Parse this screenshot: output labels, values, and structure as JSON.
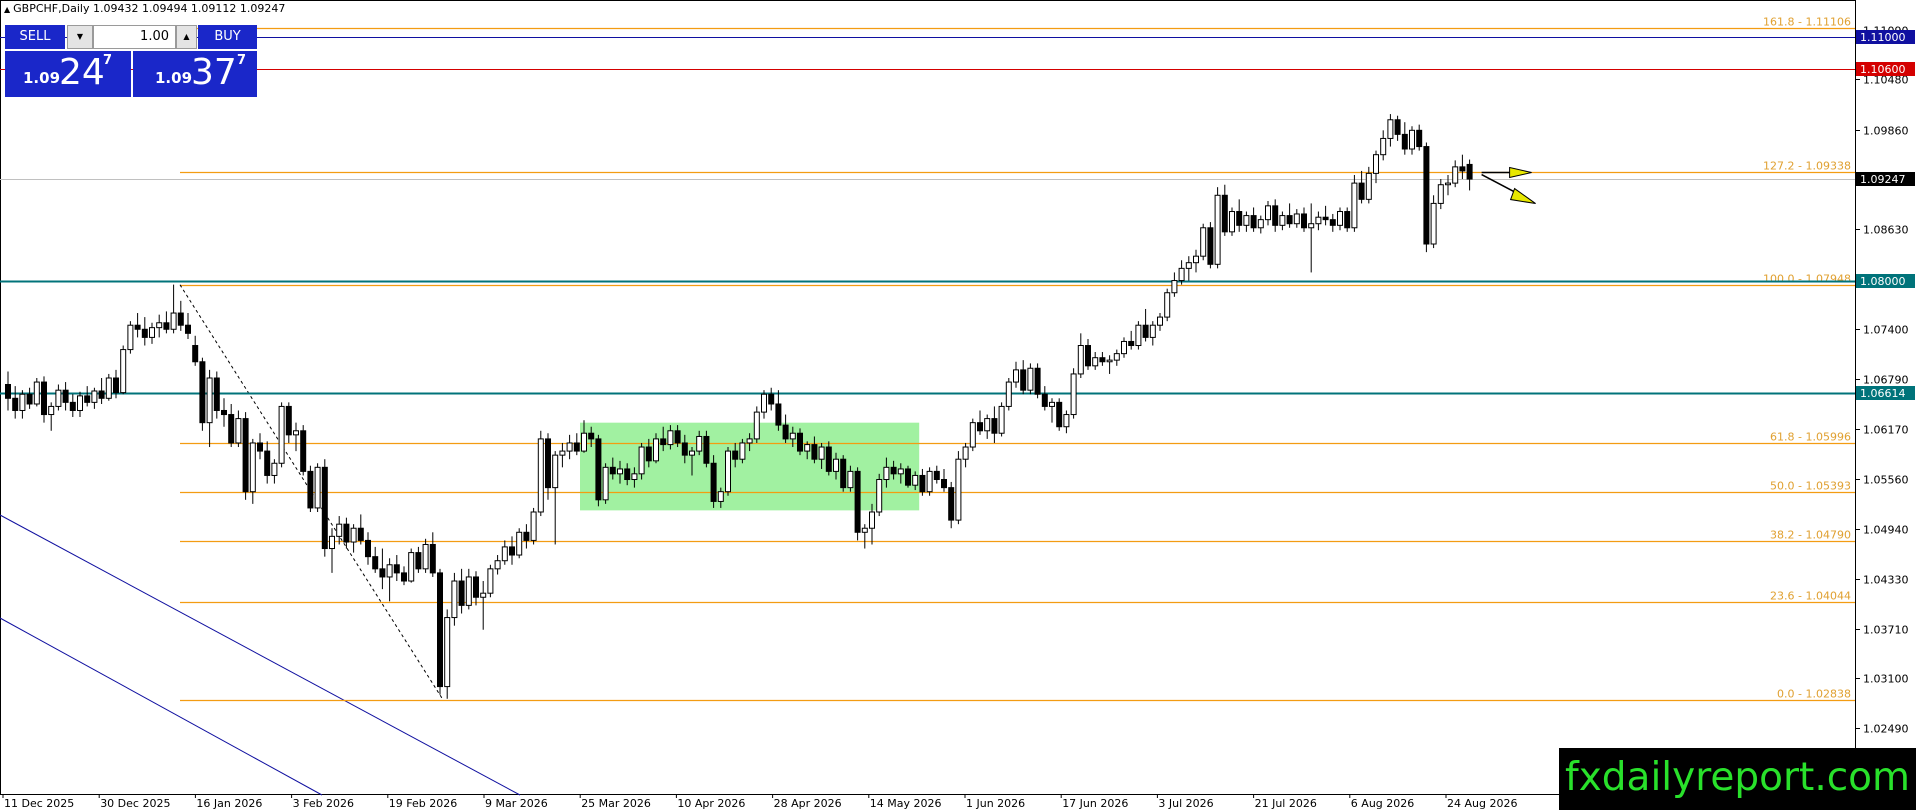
{
  "header": {
    "symbol_line": "GBPCHF,Daily  1.09432 1.09494 1.09112 1.09247"
  },
  "trade_panel": {
    "sell_label": "SELL",
    "buy_label": "BUY",
    "lot_value": "1.00",
    "sell_prefix": "1.09",
    "sell_big": "24",
    "sell_sup": "7",
    "buy_prefix": "1.09",
    "buy_big": "37",
    "buy_sup": "7"
  },
  "watermark": "fxdailyreport.com",
  "colors": {
    "up_candle": "#ffffff",
    "down_candle": "#000000",
    "fib_line": "#f39c12",
    "fib_text": "#e0a030",
    "teal_line": "#00737a",
    "blue_line": "#1010a0",
    "red_line": "#d40000",
    "consolidation_box": "#90ee90",
    "arrow_fill": "#e8e800",
    "brand_green": "#29e12b"
  },
  "chart_data": {
    "type": "candlestick",
    "symbol": "GBPCHF",
    "timeframe": "Daily",
    "ohlc_header": {
      "open": 1.09432,
      "high": 1.09494,
      "low": 1.09112,
      "close": 1.09247
    },
    "current_price": "1.09247",
    "y_ticks": [
      "1.11090",
      "1.10480",
      "1.09860",
      "1.08630",
      "1.07400",
      "1.06790",
      "1.06170",
      "1.05560",
      "1.04940",
      "1.04330",
      "1.03710",
      "1.03100",
      "1.02490"
    ],
    "x_ticks": [
      "11 Dec 2025",
      "30 Dec 2025",
      "16 Jan 2026",
      "3 Feb 2026",
      "19 Feb 2026",
      "9 Mar 2026",
      "25 Mar 2026",
      "10 Apr 2026",
      "28 Apr 2026",
      "14 May 2026",
      "1 Jun 2026",
      "17 Jun 2026",
      "3 Jul 2026",
      "21 Jul 2026",
      "6 Aug 2026",
      "24 Aug 2026"
    ],
    "fib_levels": [
      {
        "label": "161.8 - 1.11106",
        "price": 1.11106
      },
      {
        "label": "127.2 - 1.09338",
        "price": 1.09338
      },
      {
        "label": "100.0 - 1.07948",
        "price": 1.07948
      },
      {
        "label": "61.8 - 1.05996",
        "price": 1.05996
      },
      {
        "label": "50.0 - 1.05393",
        "price": 1.05393
      },
      {
        "label": "38.2 - 1.04790",
        "price": 1.0479
      },
      {
        "label": "23.6 - 1.04044",
        "price": 1.04044
      },
      {
        "label": "0.0 - 1.02838",
        "price": 1.02838
      }
    ],
    "horizontal_lines": [
      {
        "label": "1.11000",
        "price": 1.11,
        "color": "#1010a0"
      },
      {
        "label": "1.10600",
        "price": 1.106,
        "color": "#d40000"
      },
      {
        "label": "1.08000",
        "price": 1.08,
        "color": "#00737a"
      },
      {
        "label": "1.06614",
        "price": 1.06614,
        "color": "#00737a"
      }
    ],
    "consolidation_zone": {
      "start_bar": 80,
      "end_bar": 126,
      "high": 1.0625,
      "low": 1.0517
    },
    "candles": [
      [
        1.0672,
        1.0688,
        1.064,
        1.0655
      ],
      [
        1.0655,
        1.067,
        1.063,
        1.064
      ],
      [
        1.064,
        1.0665,
        1.063,
        1.066
      ],
      [
        1.066,
        1.0668,
        1.0642,
        1.0648
      ],
      [
        1.0648,
        1.068,
        1.0645,
        1.0675
      ],
      [
        1.0675,
        1.0682,
        1.0625,
        1.0635
      ],
      [
        1.0635,
        1.065,
        1.0615,
        1.0645
      ],
      [
        1.0645,
        1.0672,
        1.064,
        1.0665
      ],
      [
        1.0665,
        1.0675,
        1.064,
        1.065
      ],
      [
        1.065,
        1.066,
        1.0632,
        1.064
      ],
      [
        1.064,
        1.0663,
        1.0632,
        1.0658
      ],
      [
        1.0658,
        1.067,
        1.0645,
        1.065
      ],
      [
        1.065,
        1.0668,
        1.0642,
        1.0664
      ],
      [
        1.0664,
        1.068,
        1.0648,
        1.0655
      ],
      [
        1.0655,
        1.0685,
        1.0652,
        1.068
      ],
      [
        1.068,
        1.069,
        1.0655,
        1.0662
      ],
      [
        1.0662,
        1.072,
        1.066,
        1.0715
      ],
      [
        1.0715,
        1.075,
        1.071,
        1.0745
      ],
      [
        1.0745,
        1.076,
        1.073,
        1.074
      ],
      [
        1.074,
        1.0755,
        1.072,
        1.073
      ],
      [
        1.073,
        1.0748,
        1.0722,
        1.0742
      ],
      [
        1.0742,
        1.0758,
        1.073,
        1.0748
      ],
      [
        1.0748,
        1.0762,
        1.0735,
        1.074
      ],
      [
        1.074,
        1.0795,
        1.0735,
        1.076
      ],
      [
        1.076,
        1.0775,
        1.0738,
        1.0745
      ],
      [
        1.0745,
        1.076,
        1.0728,
        1.0735
      ],
      [
        1.072,
        1.0732,
        1.0695,
        1.07
      ],
      [
        1.07,
        1.0705,
        1.0615,
        1.0625
      ],
      [
        1.0625,
        1.069,
        1.0595,
        1.068
      ],
      [
        1.068,
        1.0688,
        1.063,
        1.064
      ],
      [
        1.064,
        1.0655,
        1.062,
        1.0635
      ],
      [
        1.0635,
        1.0648,
        1.0595,
        1.06
      ],
      [
        1.06,
        1.064,
        1.0595,
        1.063
      ],
      [
        1.063,
        1.0638,
        1.053,
        1.054
      ],
      [
        1.054,
        1.0605,
        1.0525,
        1.06
      ],
      [
        1.06,
        1.0612,
        1.058,
        1.059
      ],
      [
        1.059,
        1.0602,
        1.055,
        1.056
      ],
      [
        1.056,
        1.058,
        1.055,
        1.0575
      ],
      [
        1.0575,
        1.065,
        1.057,
        1.0645
      ],
      [
        1.0645,
        1.065,
        1.06,
        1.061
      ],
      [
        1.061,
        1.0625,
        1.059,
        1.0615
      ],
      [
        1.0615,
        1.0622,
        1.056,
        1.0565
      ],
      [
        1.0565,
        1.0572,
        1.0515,
        1.052
      ],
      [
        1.052,
        1.0575,
        1.0515,
        1.057
      ],
      [
        1.057,
        1.058,
        1.046,
        1.047
      ],
      [
        1.047,
        1.0495,
        1.044,
        1.0485
      ],
      [
        1.0485,
        1.051,
        1.0475,
        1.05
      ],
      [
        1.05,
        1.0508,
        1.047,
        1.0478
      ],
      [
        1.0478,
        1.05,
        1.0465,
        1.0495
      ],
      [
        1.0495,
        1.0512,
        1.0475,
        1.048
      ],
      [
        1.048,
        1.049,
        1.045,
        1.046
      ],
      [
        1.046,
        1.0472,
        1.044,
        1.0445
      ],
      [
        1.0445,
        1.047,
        1.042,
        1.0435
      ],
      [
        1.0435,
        1.0458,
        1.0405,
        1.045
      ],
      [
        1.045,
        1.0462,
        1.043,
        1.044
      ],
      [
        1.044,
        1.0448,
        1.0425,
        1.043
      ],
      [
        1.043,
        1.047,
        1.0428,
        1.0465
      ],
      [
        1.0465,
        1.0472,
        1.044,
        1.0445
      ],
      [
        1.0445,
        1.0482,
        1.044,
        1.0475
      ],
      [
        1.0475,
        1.049,
        1.0435,
        1.044
      ],
      [
        1.044,
        1.0445,
        1.029,
        1.03
      ],
      [
        1.03,
        1.0395,
        1.0285,
        1.0385
      ],
      [
        1.0385,
        1.044,
        1.0375,
        1.043
      ],
      [
        1.043,
        1.0445,
        1.039,
        1.04
      ],
      [
        1.04,
        1.0445,
        1.0395,
        1.0435
      ],
      [
        1.0435,
        1.0442,
        1.04,
        1.041
      ],
      [
        1.041,
        1.043,
        1.037,
        1.0415
      ],
      [
        1.0415,
        1.045,
        1.041,
        1.0445
      ],
      [
        1.0445,
        1.0462,
        1.0438,
        1.0455
      ],
      [
        1.0455,
        1.048,
        1.045,
        1.0472
      ],
      [
        1.0472,
        1.0485,
        1.045,
        1.0462
      ],
      [
        1.0462,
        1.0495,
        1.0458,
        1.049
      ],
      [
        1.049,
        1.05,
        1.047,
        1.048
      ],
      [
        1.048,
        1.052,
        1.0475,
        1.0515
      ],
      [
        1.0515,
        1.0615,
        1.051,
        1.0605
      ],
      [
        1.0605,
        1.0612,
        1.053,
        1.0545
      ],
      [
        1.0545,
        1.059,
        1.0475,
        1.0585
      ],
      [
        1.0585,
        1.06,
        1.057,
        1.059
      ],
      [
        1.059,
        1.061,
        1.058,
        1.06
      ],
      [
        1.06,
        1.0612,
        1.0585,
        1.059
      ],
      [
        1.059,
        1.0628,
        1.0588,
        1.0612
      ],
      [
        1.0612,
        1.062,
        1.0595,
        1.0605
      ],
      [
        1.0605,
        1.061,
        1.0522,
        1.053
      ],
      [
        1.053,
        1.0575,
        1.0525,
        1.057
      ],
      [
        1.057,
        1.0582,
        1.0555,
        1.0562
      ],
      [
        1.0562,
        1.0578,
        1.055,
        1.0568
      ],
      [
        1.0568,
        1.0575,
        1.0548,
        1.0555
      ],
      [
        1.0555,
        1.057,
        1.0545,
        1.0562
      ],
      [
        1.0562,
        1.06,
        1.0555,
        1.0595
      ],
      [
        1.0595,
        1.0605,
        1.057,
        1.0578
      ],
      [
        1.0578,
        1.0612,
        1.0575,
        1.0605
      ],
      [
        1.0605,
        1.062,
        1.059,
        1.0598
      ],
      [
        1.0598,
        1.0622,
        1.0592,
        1.0615
      ],
      [
        1.0615,
        1.0622,
        1.0595,
        1.06
      ],
      [
        1.06,
        1.061,
        1.0575,
        1.0585
      ],
      [
        1.0585,
        1.0595,
        1.056,
        1.059
      ],
      [
        1.059,
        1.0615,
        1.0585,
        1.0608
      ],
      [
        1.0608,
        1.0615,
        1.057,
        1.0575
      ],
      [
        1.0575,
        1.0585,
        1.052,
        1.0528
      ],
      [
        1.0528,
        1.0545,
        1.052,
        1.054
      ],
      [
        1.054,
        1.0595,
        1.0535,
        1.059
      ],
      [
        1.059,
        1.06,
        1.057,
        1.058
      ],
      [
        1.058,
        1.0605,
        1.0575,
        1.06
      ],
      [
        1.06,
        1.0612,
        1.059,
        1.0605
      ],
      [
        1.0605,
        1.0645,
        1.06,
        1.0638
      ],
      [
        1.0638,
        1.0665,
        1.063,
        1.066
      ],
      [
        1.066,
        1.0668,
        1.064,
        1.0648
      ],
      [
        1.0648,
        1.0665,
        1.0615,
        1.0622
      ],
      [
        1.0622,
        1.0635,
        1.06,
        1.0605
      ],
      [
        1.0605,
        1.062,
        1.0595,
        1.0612
      ],
      [
        1.0612,
        1.0618,
        1.0585,
        1.059
      ],
      [
        1.059,
        1.0602,
        1.058,
        1.0598
      ],
      [
        1.0598,
        1.0608,
        1.0575,
        1.058
      ],
      [
        1.058,
        1.06,
        1.0568,
        1.0595
      ],
      [
        1.0595,
        1.0602,
        1.056,
        1.0565
      ],
      [
        1.0565,
        1.0588,
        1.0555,
        1.058
      ],
      [
        1.058,
        1.0585,
        1.054,
        1.0545
      ],
      [
        1.0545,
        1.0572,
        1.054,
        1.0565
      ],
      [
        1.0565,
        1.057,
        1.048,
        1.049
      ],
      [
        1.049,
        1.05,
        1.047,
        1.0495
      ],
      [
        1.0495,
        1.0525,
        1.0475,
        1.0515
      ],
      [
        1.0515,
        1.0562,
        1.051,
        1.0555
      ],
      [
        1.0555,
        1.0582,
        1.0545,
        1.057
      ],
      [
        1.057,
        1.0578,
        1.0555,
        1.0562
      ],
      [
        1.0562,
        1.0575,
        1.055,
        1.0568
      ],
      [
        1.0568,
        1.0572,
        1.0545,
        1.0548
      ],
      [
        1.0548,
        1.0565,
        1.0542,
        1.056
      ],
      [
        1.056,
        1.0568,
        1.0535,
        1.054
      ],
      [
        1.054,
        1.057,
        1.0535,
        1.0565
      ],
      [
        1.0565,
        1.0572,
        1.055,
        1.0555
      ],
      [
        1.0555,
        1.0568,
        1.054,
        1.0545
      ],
      [
        1.0545,
        1.0552,
        1.0495,
        1.0505
      ],
      [
        1.0505,
        1.059,
        1.05,
        1.058
      ],
      [
        1.058,
        1.06,
        1.057,
        1.0595
      ],
      [
        1.0595,
        1.063,
        1.059,
        1.0625
      ],
      [
        1.0625,
        1.064,
        1.061,
        1.0615
      ],
      [
        1.0615,
        1.0635,
        1.0605,
        1.063
      ],
      [
        1.063,
        1.0645,
        1.06,
        1.0612
      ],
      [
        1.0612,
        1.065,
        1.0608,
        1.0645
      ],
      [
        1.0645,
        1.068,
        1.064,
        1.0675
      ],
      [
        1.0675,
        1.07,
        1.0668,
        1.069
      ],
      [
        1.069,
        1.0702,
        1.066,
        1.0665
      ],
      [
        1.0665,
        1.0698,
        1.066,
        1.0692
      ],
      [
        1.0692,
        1.0698,
        1.0655,
        1.066
      ],
      [
        1.066,
        1.067,
        1.064,
        1.0645
      ],
      [
        1.0645,
        1.0655,
        1.0625,
        1.065
      ],
      [
        1.065,
        1.0655,
        1.0615,
        1.062
      ],
      [
        1.062,
        1.064,
        1.0612,
        1.0635
      ],
      [
        1.0635,
        1.0692,
        1.063,
        1.0685
      ],
      [
        1.0685,
        1.0735,
        1.068,
        1.072
      ],
      [
        1.072,
        1.0728,
        1.069,
        1.0695
      ],
      [
        1.0695,
        1.0712,
        1.069,
        1.0705
      ],
      [
        1.0705,
        1.0712,
        1.0695,
        1.07
      ],
      [
        1.07,
        1.0708,
        1.0685,
        1.0702
      ],
      [
        1.0702,
        1.0715,
        1.0695,
        1.071
      ],
      [
        1.071,
        1.073,
        1.0705,
        1.0725
      ],
      [
        1.0725,
        1.0738,
        1.0715,
        1.072
      ],
      [
        1.072,
        1.075,
        1.0715,
        1.0745
      ],
      [
        1.0745,
        1.0765,
        1.0725,
        1.073
      ],
      [
        1.073,
        1.075,
        1.072,
        1.0745
      ],
      [
        1.0745,
        1.076,
        1.0738,
        1.0755
      ],
      [
        1.0755,
        1.079,
        1.075,
        1.0785
      ],
      [
        1.0785,
        1.081,
        1.078,
        1.08
      ],
      [
        1.08,
        1.0825,
        1.0795,
        1.0815
      ],
      [
        1.0815,
        1.083,
        1.08,
        1.0822
      ],
      [
        1.0822,
        1.0838,
        1.081,
        1.083
      ],
      [
        1.083,
        1.087,
        1.0825,
        1.0865
      ],
      [
        1.0865,
        1.0872,
        1.0815,
        1.082
      ],
      [
        1.082,
        1.0915,
        1.0815,
        1.0905
      ],
      [
        1.0905,
        1.0918,
        1.0855,
        1.086
      ],
      [
        1.086,
        1.089,
        1.0855,
        1.0885
      ],
      [
        1.0885,
        1.09,
        1.086,
        1.0868
      ],
      [
        1.0868,
        1.0885,
        1.086,
        1.088
      ],
      [
        1.088,
        1.089,
        1.086,
        1.0865
      ],
      [
        1.0865,
        1.088,
        1.0858,
        1.0875
      ],
      [
        1.0875,
        1.0898,
        1.0868,
        1.0892
      ],
      [
        1.0892,
        1.09,
        1.086,
        1.0868
      ],
      [
        1.0868,
        1.0885,
        1.0862,
        1.088
      ],
      [
        1.088,
        1.0895,
        1.0865,
        1.087
      ],
      [
        1.087,
        1.0888,
        1.0865,
        1.0882
      ],
      [
        1.0882,
        1.089,
        1.086,
        1.0865
      ],
      [
        1.0865,
        1.0895,
        1.081,
        1.087
      ],
      [
        1.087,
        1.0885,
        1.0862,
        1.0878
      ],
      [
        1.0878,
        1.0892,
        1.0868,
        1.0875
      ],
      [
        1.0875,
        1.0882,
        1.086,
        1.0868
      ],
      [
        1.0868,
        1.089,
        1.0862,
        1.0885
      ],
      [
        1.0885,
        1.089,
        1.086,
        1.0865
      ],
      [
        1.0865,
        1.093,
        1.086,
        1.092
      ],
      [
        1.092,
        1.0935,
        1.0895,
        1.09
      ],
      [
        1.09,
        1.094,
        1.0895,
        1.0932
      ],
      [
        1.0932,
        1.096,
        1.092,
        1.0955
      ],
      [
        1.0955,
        1.0985,
        1.0948,
        1.0975
      ],
      [
        1.0975,
        1.1005,
        1.0965,
        1.0998
      ],
      [
        1.0998,
        1.1003,
        1.0972,
        1.098
      ],
      [
        1.098,
        1.0995,
        1.0955,
        1.0962
      ],
      [
        1.0962,
        1.099,
        1.0955,
        1.0985
      ],
      [
        1.0985,
        1.0992,
        1.096,
        1.0965
      ],
      [
        1.0965,
        1.097,
        1.0835,
        1.0845
      ],
      [
        1.0845,
        1.0905,
        1.084,
        1.0895
      ],
      [
        1.0895,
        1.0925,
        1.0888,
        1.0918
      ],
      [
        1.0918,
        1.093,
        1.0905,
        1.092
      ],
      [
        1.092,
        1.0948,
        1.0915,
        1.094
      ],
      [
        1.094,
        1.0955,
        1.0925,
        1.0935
      ],
      [
        1.0943,
        1.0949,
        1.0911,
        1.0925
      ]
    ]
  }
}
